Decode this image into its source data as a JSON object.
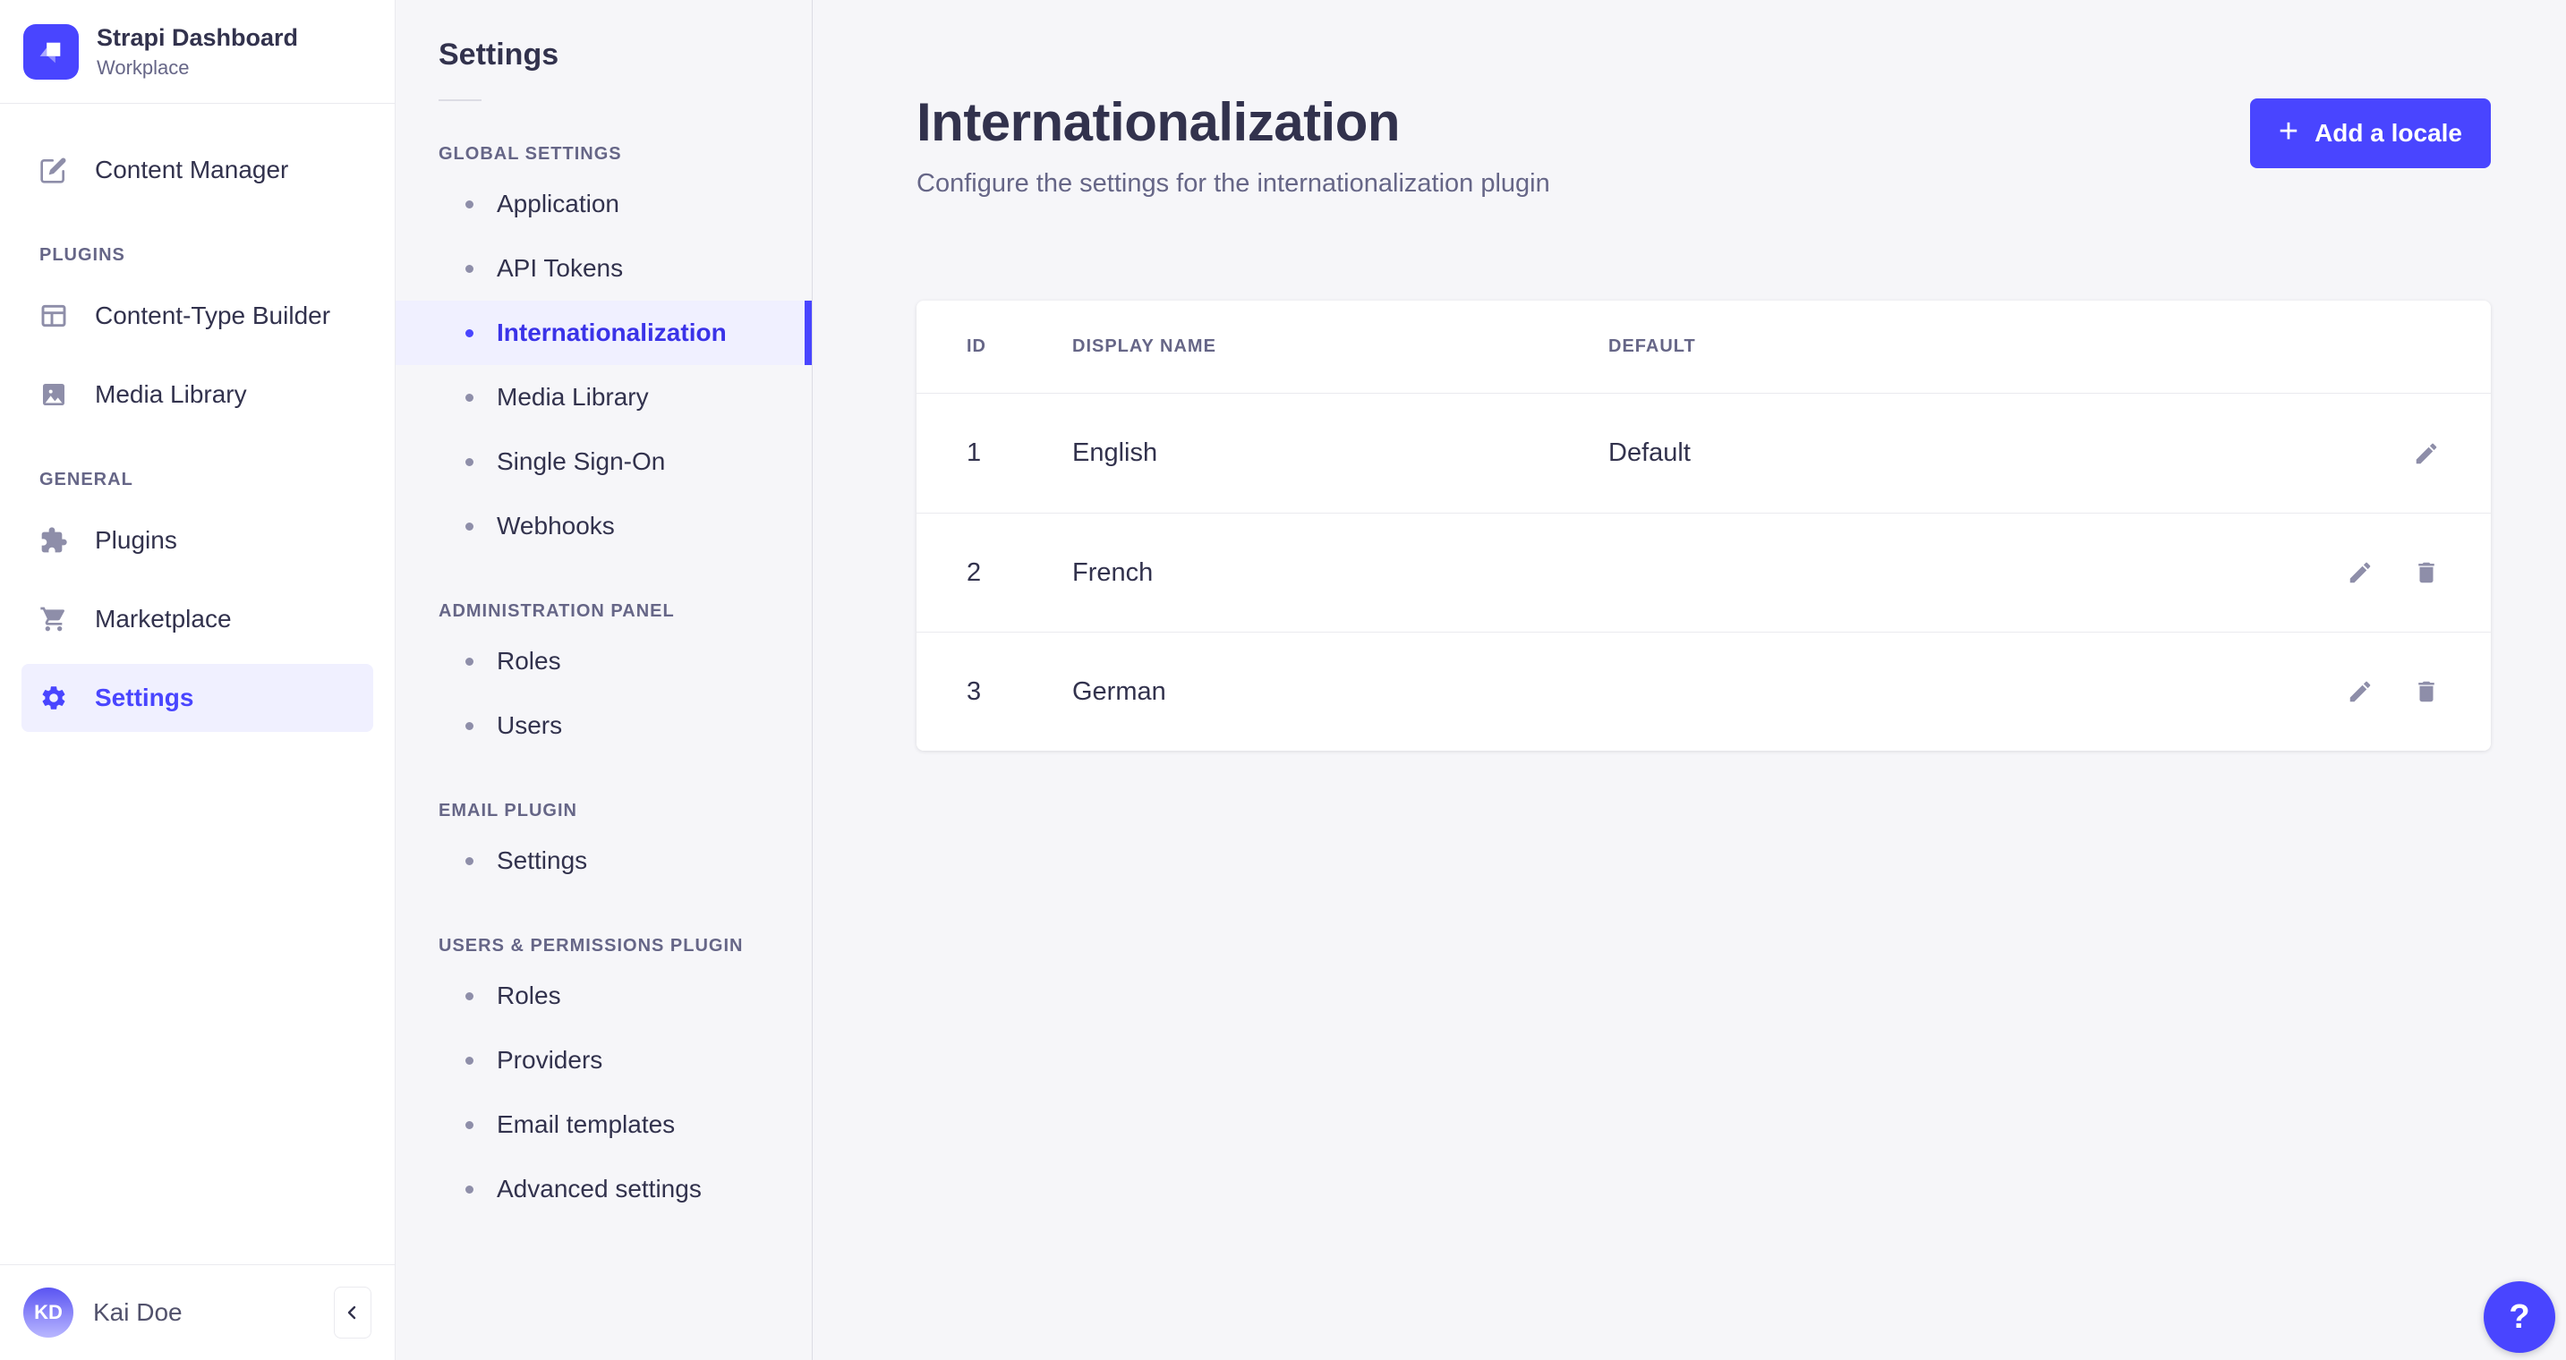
{
  "colors": {
    "primary": "#4945ff",
    "primary_light_bg": "#f0f0ff",
    "text_dark": "#32324d",
    "text_muted": "#666687",
    "icon_gray": "#8e8ea9",
    "border": "#eaeaef",
    "surface": "#ffffff",
    "page_bg": "#f6f6f9"
  },
  "main_sidebar": {
    "brand_title": "Strapi Dashboard",
    "brand_subtitle": "Workplace",
    "logo_icon": "strapi-logo-icon",
    "items_top": [
      {
        "label": "Content Manager",
        "icon": "content-manager-icon"
      }
    ],
    "sections": [
      {
        "title": "PLUGINS",
        "items": [
          {
            "label": "Content-Type Builder",
            "icon": "content-type-builder-icon"
          },
          {
            "label": "Media Library",
            "icon": "media-library-icon"
          }
        ]
      },
      {
        "title": "GENERAL",
        "items": [
          {
            "label": "Plugins",
            "icon": "plugins-icon"
          },
          {
            "label": "Marketplace",
            "icon": "marketplace-icon"
          },
          {
            "label": "Settings",
            "icon": "settings-icon",
            "active": true
          }
        ]
      }
    ],
    "user": {
      "initials": "KD",
      "name": "Kai Doe"
    },
    "collapse_icon": "chevron-left-icon"
  },
  "settings_nav": {
    "title": "Settings",
    "sections": [
      {
        "title": "GLOBAL SETTINGS",
        "items": [
          {
            "label": "Application"
          },
          {
            "label": "API Tokens"
          },
          {
            "label": "Internationalization",
            "active": true
          },
          {
            "label": "Media Library"
          },
          {
            "label": "Single Sign-On"
          },
          {
            "label": "Webhooks"
          }
        ]
      },
      {
        "title": "ADMINISTRATION PANEL",
        "items": [
          {
            "label": "Roles"
          },
          {
            "label": "Users"
          }
        ]
      },
      {
        "title": "EMAIL PLUGIN",
        "items": [
          {
            "label": "Settings"
          }
        ]
      },
      {
        "title": "USERS & PERMISSIONS PLUGIN",
        "items": [
          {
            "label": "Roles"
          },
          {
            "label": "Providers"
          },
          {
            "label": "Email templates"
          },
          {
            "label": "Advanced settings"
          }
        ]
      }
    ]
  },
  "content": {
    "title": "Internationalization",
    "subtitle": "Configure the settings for the internationalization plugin",
    "add_button": {
      "label": "Add a locale",
      "icon": "plus-icon"
    },
    "table": {
      "headers": [
        "ID",
        "DISPLAY NAME",
        "DEFAULT"
      ],
      "rows": [
        {
          "id": "1",
          "display_name": "English",
          "default_label": "Default",
          "actions": [
            "edit"
          ]
        },
        {
          "id": "2",
          "display_name": "French",
          "default_label": "",
          "actions": [
            "edit",
            "delete"
          ]
        },
        {
          "id": "3",
          "display_name": "German",
          "default_label": "",
          "actions": [
            "edit",
            "delete"
          ]
        }
      ]
    }
  },
  "help_button": {
    "label": "?",
    "icon": "question-mark-icon"
  }
}
